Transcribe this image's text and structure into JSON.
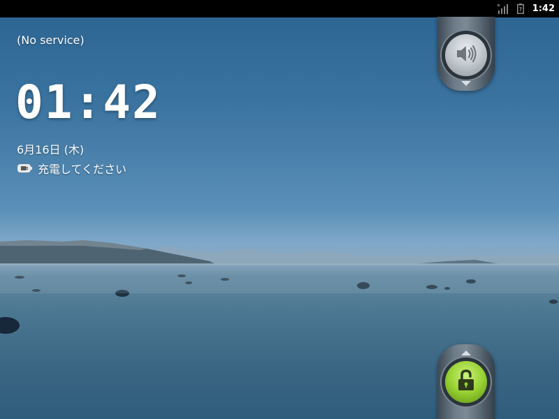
{
  "status_bar": {
    "time": "1:42",
    "icons": [
      "signal-icon",
      "battery-icon"
    ]
  },
  "lockscreen": {
    "carrier": "(No service)",
    "clock": "01:42",
    "date": "6月16日 (木)",
    "charge_message": "充電してください",
    "charge_icon": "battery-plug-icon"
  },
  "handles": {
    "sound": {
      "icon": "speaker-icon"
    },
    "unlock": {
      "icon": "unlocked-padlock-icon"
    }
  },
  "colors": {
    "status_bar_bg": "#000000",
    "unlock_green": "#97d131",
    "text": "#ffffff"
  }
}
